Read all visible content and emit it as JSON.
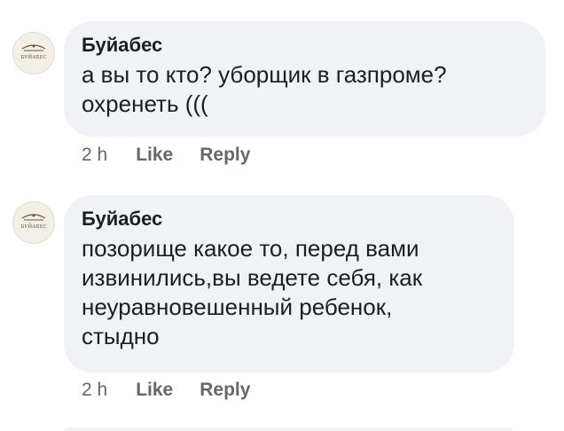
{
  "comments": [
    {
      "avatar_icon": "page-logo-icon",
      "avatar_text": "БУЙАБЕС",
      "author": "Буйабес",
      "text": "а вы то кто? уборщик в газпроме?\nохренеть (((",
      "time": "2 h",
      "like": "Like",
      "reply": "Reply"
    },
    {
      "avatar_icon": "page-logo-icon",
      "avatar_text": "БУЙАБЕС",
      "author": "Буйабес",
      "text": "позорище какое то, перед вами\nизвинились,вы ведете себя, как\nнеуравновешенный ребенок,\nстыдно",
      "time": "2 h",
      "like": "Like",
      "reply": "Reply"
    }
  ],
  "colors": {
    "bubble": "#f0f2f5",
    "secondary_text": "#65676b",
    "primary_text": "#1c1e21"
  }
}
